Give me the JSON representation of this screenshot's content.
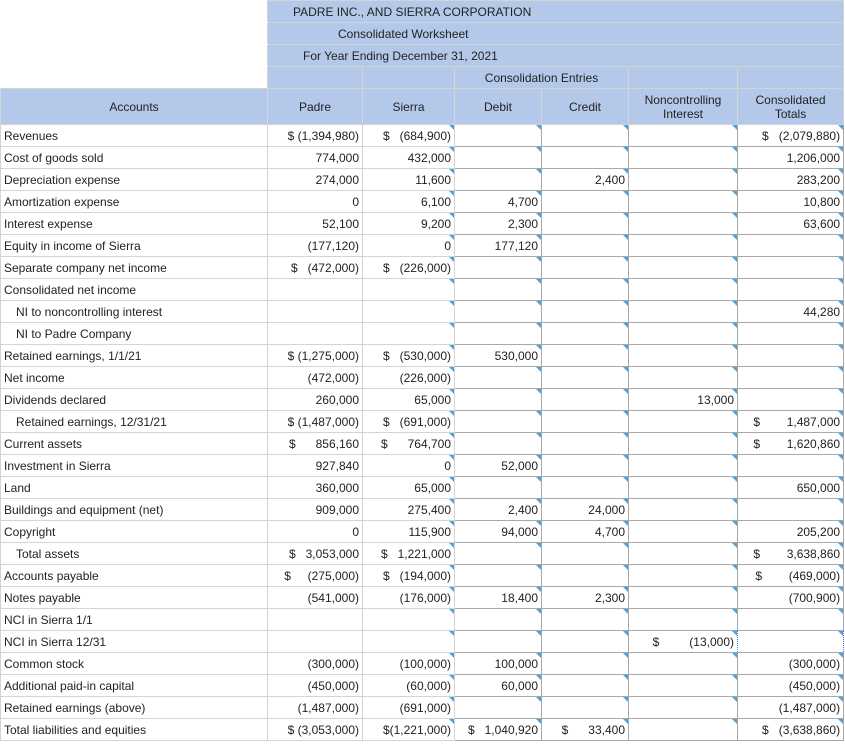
{
  "title_lines": [
    "PADRE INC., AND SIERRA CORPORATION",
    "Consolidated Worksheet",
    "For Year Ending December 31, 2021"
  ],
  "cons_entries_label": "Consolidation Entries",
  "columns": {
    "accounts": "Accounts",
    "padre": "Padre",
    "sierra": "Sierra",
    "debit": "Debit",
    "credit": "Credit",
    "nci": [
      "Noncontrolling",
      "Interest"
    ],
    "totals": [
      "Consolidated",
      "Totals"
    ]
  },
  "rows": [
    {
      "account": "Revenues",
      "padre": "$ (1,394,980)",
      "sierra": "$   (684,900)",
      "debit": "",
      "credit": "",
      "nci": "",
      "total": "$   (2,079,880)"
    },
    {
      "account": "Cost of goods sold",
      "padre": "774,000",
      "sierra": "432,000",
      "debit": "",
      "credit": "",
      "nci": "",
      "total": "1,206,000"
    },
    {
      "account": "Depreciation expense",
      "padre": "274,000",
      "sierra": "11,600",
      "debit": "",
      "credit": "2,400",
      "nci": "",
      "total": "283,200"
    },
    {
      "account": "Amortization expense",
      "padre": "0",
      "sierra": "6,100",
      "debit": "4,700",
      "credit": "",
      "nci": "",
      "total": "10,800"
    },
    {
      "account": "Interest expense",
      "padre": "52,100",
      "sierra": "9,200",
      "debit": "2,300",
      "credit": "",
      "nci": "",
      "total": "63,600"
    },
    {
      "account": "Equity in income of Sierra",
      "padre": "(177,120)",
      "sierra": "0",
      "debit": "177,120",
      "credit": "",
      "nci": "",
      "total": ""
    },
    {
      "account": "Separate company net income",
      "padre": "$   (472,000)",
      "sierra": "$   (226,000)",
      "debit": "",
      "credit": "",
      "nci": "",
      "total": ""
    },
    {
      "account": "Consolidated net income",
      "padre": "",
      "sierra": "",
      "debit": "",
      "credit": "",
      "nci": "",
      "total": ""
    },
    {
      "account": "NI to noncontrolling interest",
      "padre": "",
      "sierra": "",
      "debit": "",
      "credit": "",
      "nci": "",
      "total": "44,280"
    },
    {
      "account": "NI to Padre Company",
      "padre": "",
      "sierra": "",
      "debit": "",
      "credit": "",
      "nci": "",
      "total": ""
    },
    {
      "account": "Retained earnings, 1/1/21",
      "padre": "$ (1,275,000)",
      "sierra": "$   (530,000)",
      "debit": "530,000",
      "credit": "",
      "nci": "",
      "total": ""
    },
    {
      "account": "Net income",
      "padre": "(472,000)",
      "sierra": "(226,000)",
      "debit": "",
      "credit": "",
      "nci": "",
      "total": ""
    },
    {
      "account": "Dividends declared",
      "padre": "260,000",
      "sierra": "65,000",
      "debit": "",
      "credit": "",
      "nci": "13,000",
      "total": ""
    },
    {
      "account": "Retained earnings, 12/31/21",
      "padre": "$ (1,487,000)",
      "sierra": "$   (691,000)",
      "debit": "",
      "credit": "",
      "nci": "",
      "total": "$        1,487,000"
    },
    {
      "account": "Current assets",
      "padre": "$      856,160",
      "sierra": "$      764,700",
      "debit": "",
      "credit": "",
      "nci": "",
      "total": "$        1,620,860"
    },
    {
      "account": "Investment in Sierra",
      "padre": "927,840",
      "sierra": "0",
      "debit": "52,000",
      "credit": "",
      "nci": "",
      "total": ""
    },
    {
      "account": "Land",
      "padre": "360,000",
      "sierra": "65,000",
      "debit": "",
      "credit": "",
      "nci": "",
      "total": "650,000"
    },
    {
      "account": "Buildings and equipment (net)",
      "padre": "909,000",
      "sierra": "275,400",
      "debit": "2,400",
      "credit": "24,000",
      "nci": "",
      "total": ""
    },
    {
      "account": "Copyright",
      "padre": "0",
      "sierra": "115,900",
      "debit": "94,000",
      "credit": "4,700",
      "nci": "",
      "total": "205,200"
    },
    {
      "account": "Total assets",
      "padre": "$   3,053,000",
      "sierra": "$   1,221,000",
      "debit": "",
      "credit": "",
      "nci": "",
      "total": "$        3,638,860"
    },
    {
      "account": "Accounts payable",
      "padre": "$     (275,000)",
      "sierra": "$   (194,000)",
      "debit": "",
      "credit": "",
      "nci": "",
      "total": "$        (469,000)"
    },
    {
      "account": "Notes payable",
      "padre": "(541,000)",
      "sierra": "(176,000)",
      "debit": "18,400",
      "credit": "2,300",
      "nci": "",
      "total": "(700,900)"
    },
    {
      "account": "NCI in Sierra 1/1",
      "padre": "",
      "sierra": "",
      "debit": "",
      "credit": "",
      "nci": "",
      "total": ""
    },
    {
      "account": "NCI in Sierra 12/31",
      "padre": "",
      "sierra": "",
      "debit": "",
      "credit": "",
      "nci": "$         (13,000)",
      "total": ""
    },
    {
      "account": "Common stock",
      "padre": "(300,000)",
      "sierra": "(100,000)",
      "debit": "100,000",
      "credit": "",
      "nci": "",
      "total": "(300,000)"
    },
    {
      "account": "Additional paid-in capital",
      "padre": "(450,000)",
      "sierra": "(60,000)",
      "debit": "60,000",
      "credit": "",
      "nci": "",
      "total": "(450,000)"
    },
    {
      "account": "Retained earnings (above)",
      "padre": "(1,487,000)",
      "sierra": "(691,000)",
      "debit": "",
      "credit": "",
      "nci": "",
      "total": "(1,487,000)"
    },
    {
      "account": "Total liabilities and equities",
      "padre": "$ (3,053,000)",
      "sierra": "$(1,221,000)",
      "debit": "$   1,040,920",
      "credit": "$      33,400",
      "nci": "",
      "total": "$   (3,638,860)"
    }
  ]
}
